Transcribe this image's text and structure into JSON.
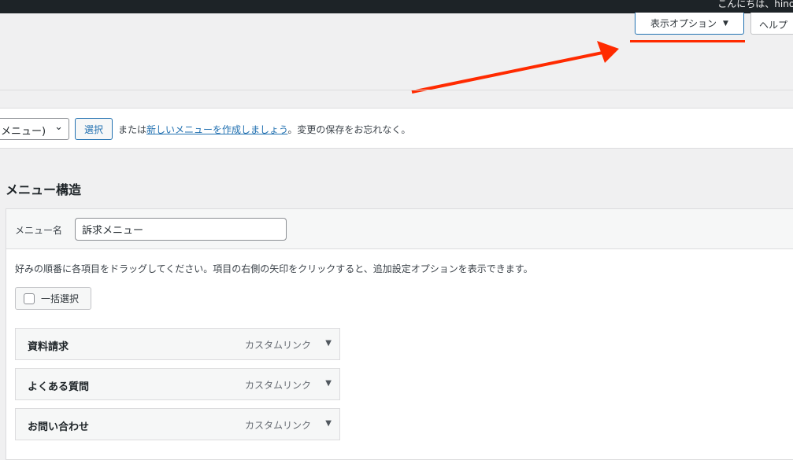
{
  "adminbar": {
    "greeting": "こんにちは、hino さん"
  },
  "screen_options": {
    "label": "表示オプション",
    "arrow": "▼"
  },
  "help": {
    "label": "ヘルプ"
  },
  "manage": {
    "select_value": "メニュー)",
    "select_button": "選択",
    "text_before": "または",
    "link_text": "新しいメニューを作成しましょう",
    "text_after": "。変更の保存をお忘れなく。"
  },
  "menu_structure": {
    "title": "メニュー構造",
    "name_label": "メニュー名",
    "name_value": "訴求メニュー",
    "instructions": "好みの順番に各項目をドラッグしてください。項目の右側の矢印をクリックすると、追加設定オプションを表示できます。",
    "bulk_select_label": "一括選択",
    "items": [
      {
        "title": "資料請求",
        "type": "カスタムリンク"
      },
      {
        "title": "よくある質問",
        "type": "カスタムリンク"
      },
      {
        "title": "お問い合わせ",
        "type": "カスタムリンク"
      }
    ]
  },
  "colors": {
    "annotation": "#ff2a00",
    "accent": "#2271b1"
  }
}
